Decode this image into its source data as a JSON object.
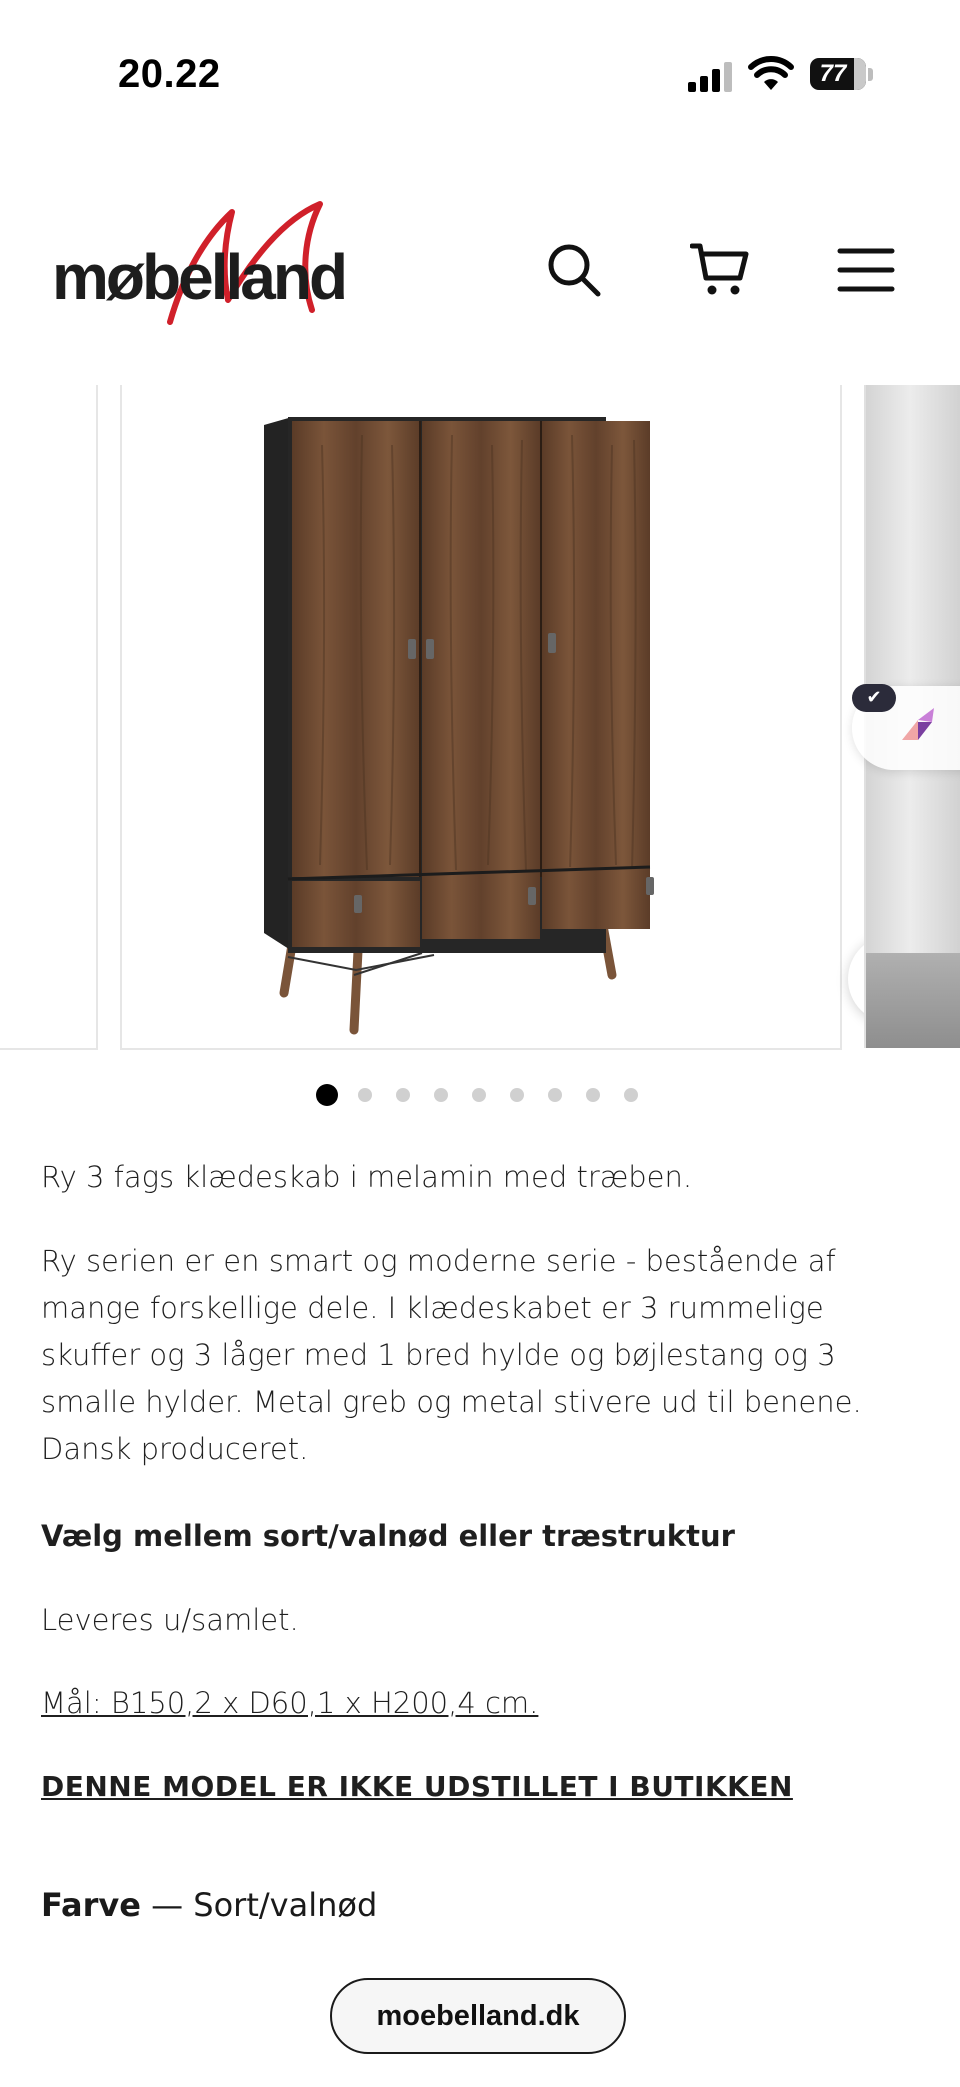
{
  "status_bar": {
    "time": "20.22",
    "battery": "77"
  },
  "header": {
    "logo_text": "møbelland",
    "icons": [
      "search-icon",
      "cart-icon",
      "menu-icon"
    ]
  },
  "gallery": {
    "slide_count": 9,
    "active_slide": 1,
    "zoom_icon": "zoom-icon"
  },
  "product": {
    "intro": "Ry 3 fags klædeskab i melamin med træben.",
    "description": "Ry serien er en smart og moderne serie - bestående af mange forskellige dele. I klædeskabet er 3 rummelige skuffer og 3 låger med 1 bred hylde og bøjlestang og 3 smalle hylder. Metal greb og metal stivere ud til benene. Dansk produceret.",
    "options_heading": "Vælg mellem sort/valnød eller træstruktur",
    "delivery": "Leveres u/samlet.",
    "dimensions": "Mål: B150,2 x D60,1 x H200,4 cm.",
    "store_notice": "DENNE MODEL ER IKKE UDSTILLET I BUTIKKEN",
    "color_label": "Farve",
    "color_separator": " — ",
    "color_value": "Sort/valnød"
  },
  "browser": {
    "url": "moebelland.dk"
  },
  "colors": {
    "brand_red": "#d0202a",
    "text": "#1f1f1f",
    "wood": "#6b4a33",
    "cabinet_black": "#262626"
  }
}
